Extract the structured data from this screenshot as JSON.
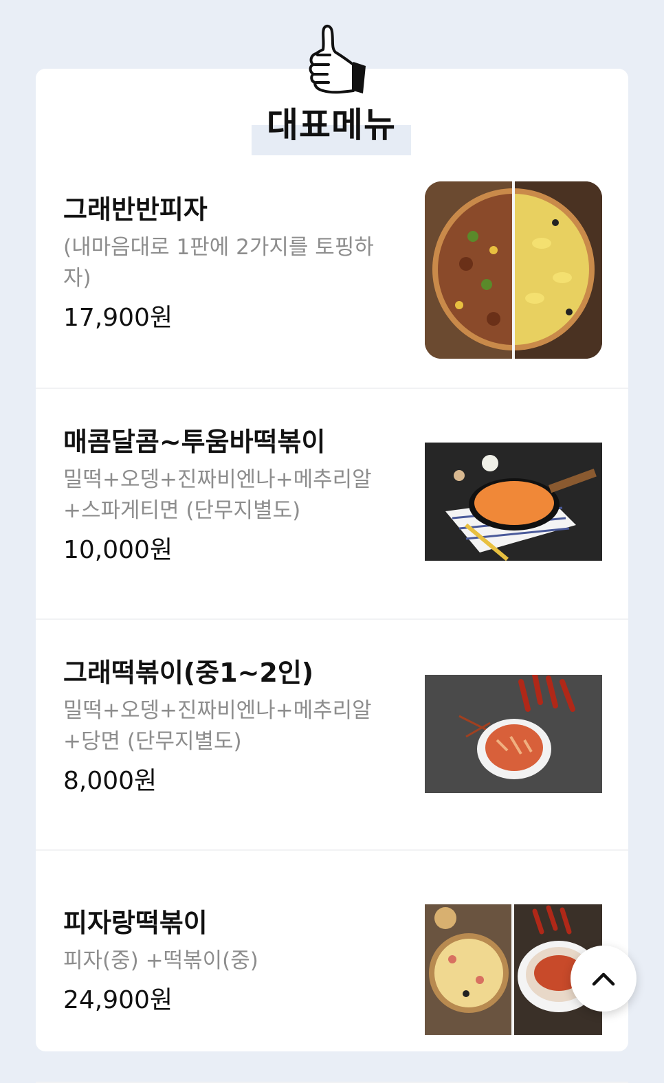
{
  "section": {
    "title": "대표메뉴",
    "icon": "thumbs-up-icon"
  },
  "menu": [
    {
      "name": "그래반반피자",
      "description": "(내마음대로 1판에 2가지를 토핑하자)",
      "price": "17,900원"
    },
    {
      "name": "매콤달콤~투움바떡볶이",
      "description": "밀떡+오뎅+진짜비엔나+메추리알+스파게티면 (단무지별도)",
      "price": "10,000원"
    },
    {
      "name": "그래떡볶이(중1~2인)",
      "description": "밀떡+오뎅+진짜비엔나+메추리알+당면 (단무지별도)",
      "price": "8,000원"
    },
    {
      "name": "피자랑떡볶이",
      "description": "피자(중) +떡볶이(중)",
      "price": "24,900원"
    }
  ],
  "scroll_top": {
    "icon": "chevron-up-icon"
  },
  "colors": {
    "background": "#e9eef6",
    "card": "#ffffff",
    "title_highlight": "#e6ecf5",
    "description": "#8d8d8d"
  }
}
